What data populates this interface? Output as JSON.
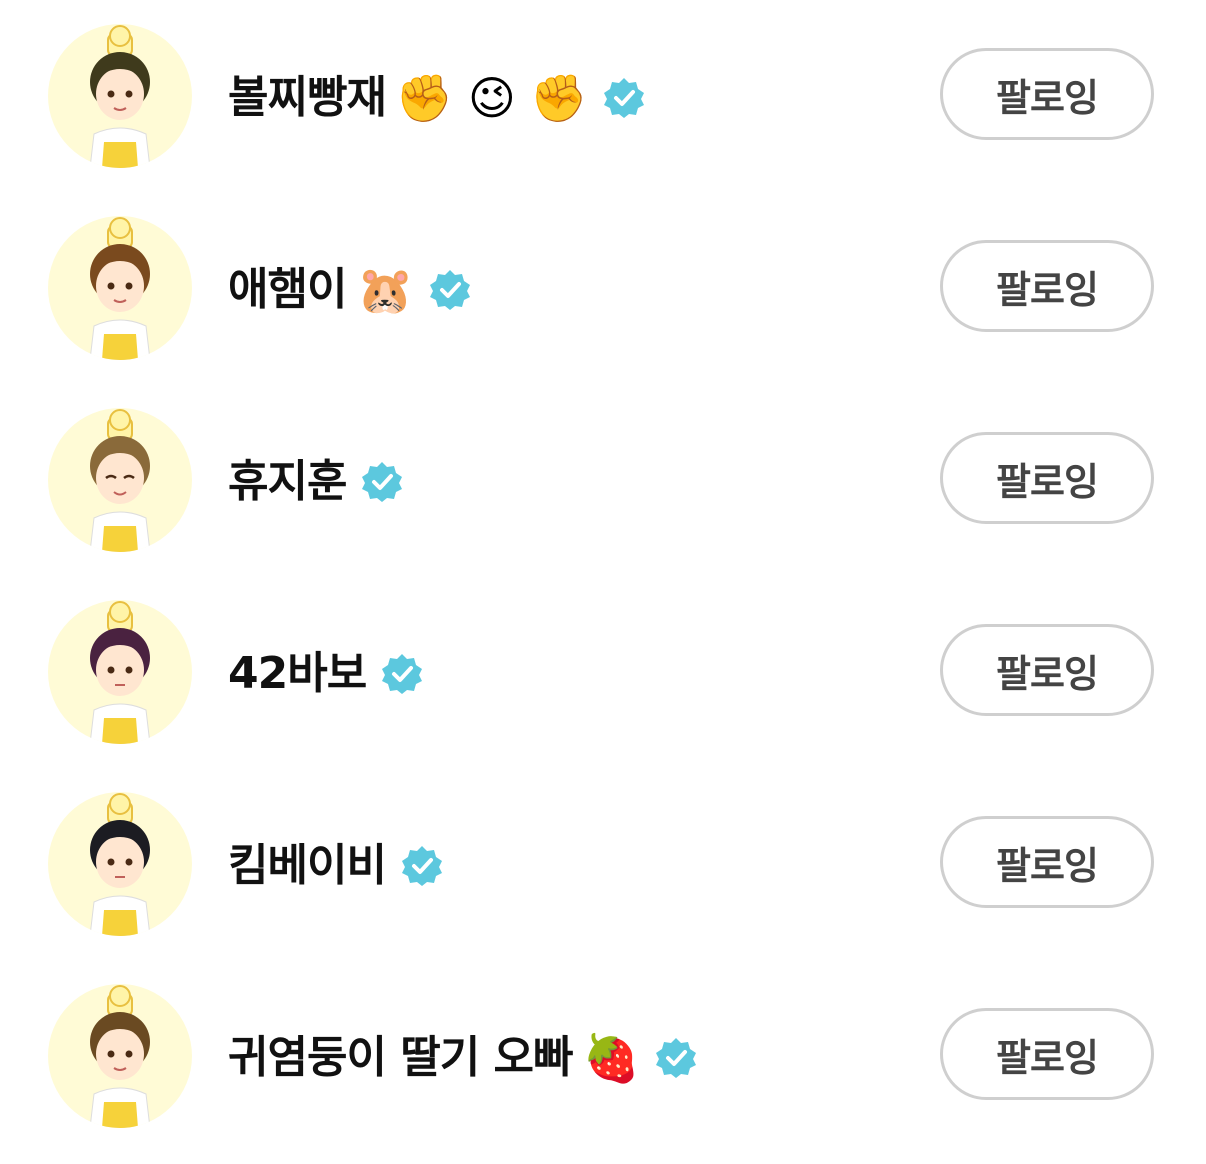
{
  "colors": {
    "avatar_bg": "#fffbd6",
    "badge": "#5cc8de",
    "button_border": "#cfcfcf",
    "button_text": "#444444",
    "name_text": "#111111"
  },
  "follow_list": [
    {
      "name": "볼찌빵재",
      "emoji": "✊ 😉 ✊",
      "verified": true,
      "button_label": "팔로잉",
      "hair_color": "#3f3a1c"
    },
    {
      "name": "애햄이",
      "emoji": "🐹",
      "verified": true,
      "button_label": "팔로잉",
      "hair_color": "#7a4a1e"
    },
    {
      "name": "휴지훈",
      "emoji": "",
      "verified": true,
      "button_label": "팔로잉",
      "hair_color": "#8a6a3a"
    },
    {
      "name": "42바보",
      "emoji": "",
      "verified": true,
      "button_label": "팔로잉",
      "hair_color": "#4a2240"
    },
    {
      "name": "킴베이비",
      "emoji": "",
      "verified": true,
      "button_label": "팔로잉",
      "hair_color": "#1c1c22"
    },
    {
      "name": "귀염둥이 딸기 오빠",
      "emoji": "🍓",
      "verified": true,
      "button_label": "팔로잉",
      "hair_color": "#6a4a22"
    }
  ]
}
